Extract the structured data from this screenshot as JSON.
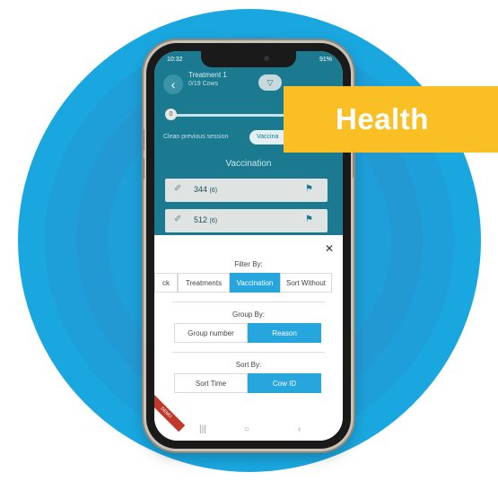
{
  "status": {
    "time": "10:32",
    "battery": "91%"
  },
  "header": {
    "title": "Treatment 1",
    "subtitle": "0/19 Cows",
    "slider_value": "0"
  },
  "session": {
    "clean_label": "Clean previous session",
    "chip_label": "Vaccina"
  },
  "list": {
    "section_title": "Vaccination",
    "rows": [
      {
        "id": "344",
        "count": "(6)"
      },
      {
        "id": "512",
        "count": "(6)"
      }
    ]
  },
  "overlay": {
    "filter_label": "Filter By:",
    "filter_options": [
      "ck",
      "Treatments",
      "Vaccination",
      "Sort Without"
    ],
    "group_label": "Group By:",
    "group_options": [
      "Group number",
      "Reason"
    ],
    "sort_label": "Sort By:",
    "sort_options": [
      "Sort Time",
      "Cow ID"
    ]
  },
  "demo_badge": "DEMO",
  "banner": {
    "text": "Health",
    "color": "#f9bf24"
  },
  "colors": {
    "circle": "#1aa7e0",
    "header": "#1b7a90",
    "active": "#26a6dd"
  },
  "icons": {
    "back": "chevron-left-icon",
    "close": "close-icon"
  }
}
